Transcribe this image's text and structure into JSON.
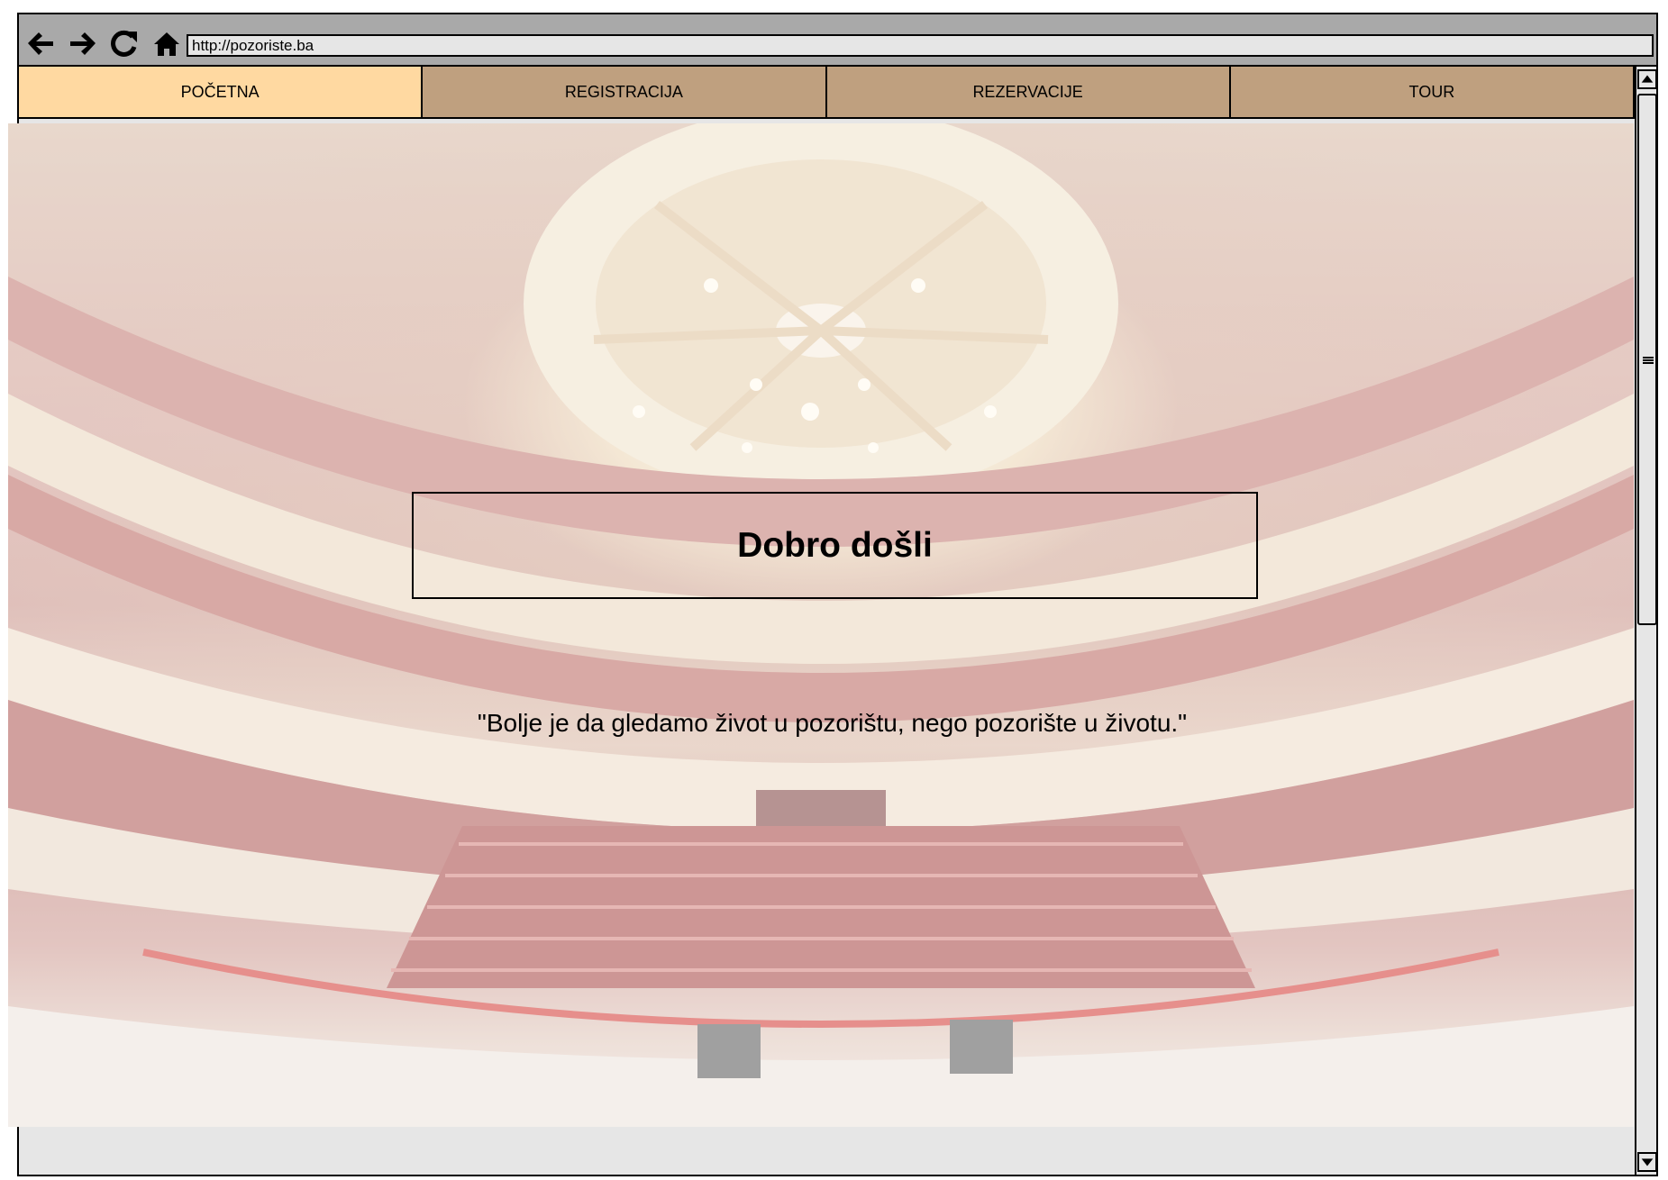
{
  "browser": {
    "url": "http://pozoriste.ba",
    "icons": [
      "back-arrow-icon",
      "forward-arrow-icon",
      "reload-icon",
      "home-icon"
    ]
  },
  "nav": {
    "tabs": [
      {
        "label": "POČETNA",
        "active": true
      },
      {
        "label": "REGISTRACIJA",
        "active": false
      },
      {
        "label": "REZERVACIJE",
        "active": false
      },
      {
        "label": "TOUR",
        "active": false
      }
    ]
  },
  "hero": {
    "title": "Dobro došli",
    "quote": "\"Bolje je da gledamo život u pozorištu, nego pozorište u životu.\""
  },
  "colors": {
    "tab_active": "#ffd9a1",
    "tab_inactive": "#bfa07f",
    "toolbar": "#a9a9a9",
    "frame": "#e6e6e6"
  }
}
